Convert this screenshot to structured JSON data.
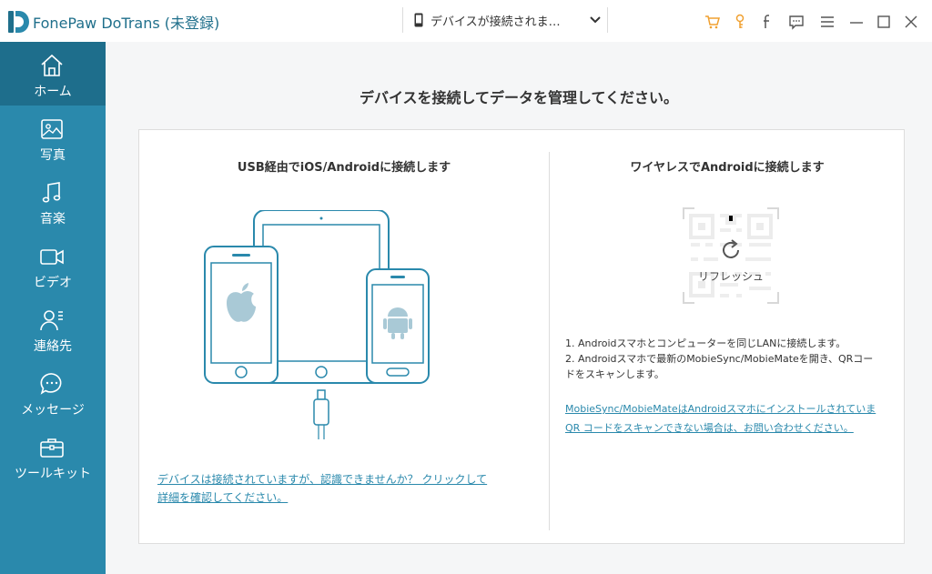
{
  "app": {
    "title": "FonePaw DoTrans (未登録)",
    "accent": "#2a89ac",
    "accent_dark": "#1e6e8c",
    "orange": "#f0a030"
  },
  "device_selector": {
    "label": "デバイスが接続されま…",
    "icon": "phone-icon"
  },
  "titlebar_icons": [
    "cart-icon",
    "key-icon",
    "facebook-icon",
    "feedback-icon",
    "menu-icon",
    "minimize-icon",
    "maximize-icon",
    "close-icon"
  ],
  "sidebar": {
    "items": [
      {
        "label": "ホーム",
        "icon": "home-icon",
        "active": true
      },
      {
        "label": "写真",
        "icon": "photo-icon",
        "active": false
      },
      {
        "label": "音楽",
        "icon": "music-icon",
        "active": false
      },
      {
        "label": "ビデオ",
        "icon": "video-icon",
        "active": false
      },
      {
        "label": "連絡先",
        "icon": "contacts-icon",
        "active": false
      },
      {
        "label": "メッセージ",
        "icon": "message-icon",
        "active": false
      },
      {
        "label": "ツールキット",
        "icon": "toolkit-icon",
        "active": false
      }
    ]
  },
  "main": {
    "heading": "デバイスを接続してデータを管理してください。",
    "usb": {
      "title": "USB経由でiOS/Androidに接続します",
      "help_line1": "デバイスは接続されていますが、認識できませんか？ クリックして",
      "help_line2": "詳細を確認してください。"
    },
    "wireless": {
      "title": "ワイヤレスでAndroidに接続します",
      "refresh_label": "リフレッシュ",
      "step1": "1. Androidスマホとコンピューターを同じLANに接続します。",
      "step2": "2. Androidスマホで最新のMobieSync/MobieMateを開き、QRコー",
      "step2b": "ドをスキャンします。",
      "link_line1": "MobieSync/MobieMateはAndroidスマホにインストールされていま",
      "link_line2": "QR コードをスキャンできない場合は、お問い合わせください。"
    }
  }
}
